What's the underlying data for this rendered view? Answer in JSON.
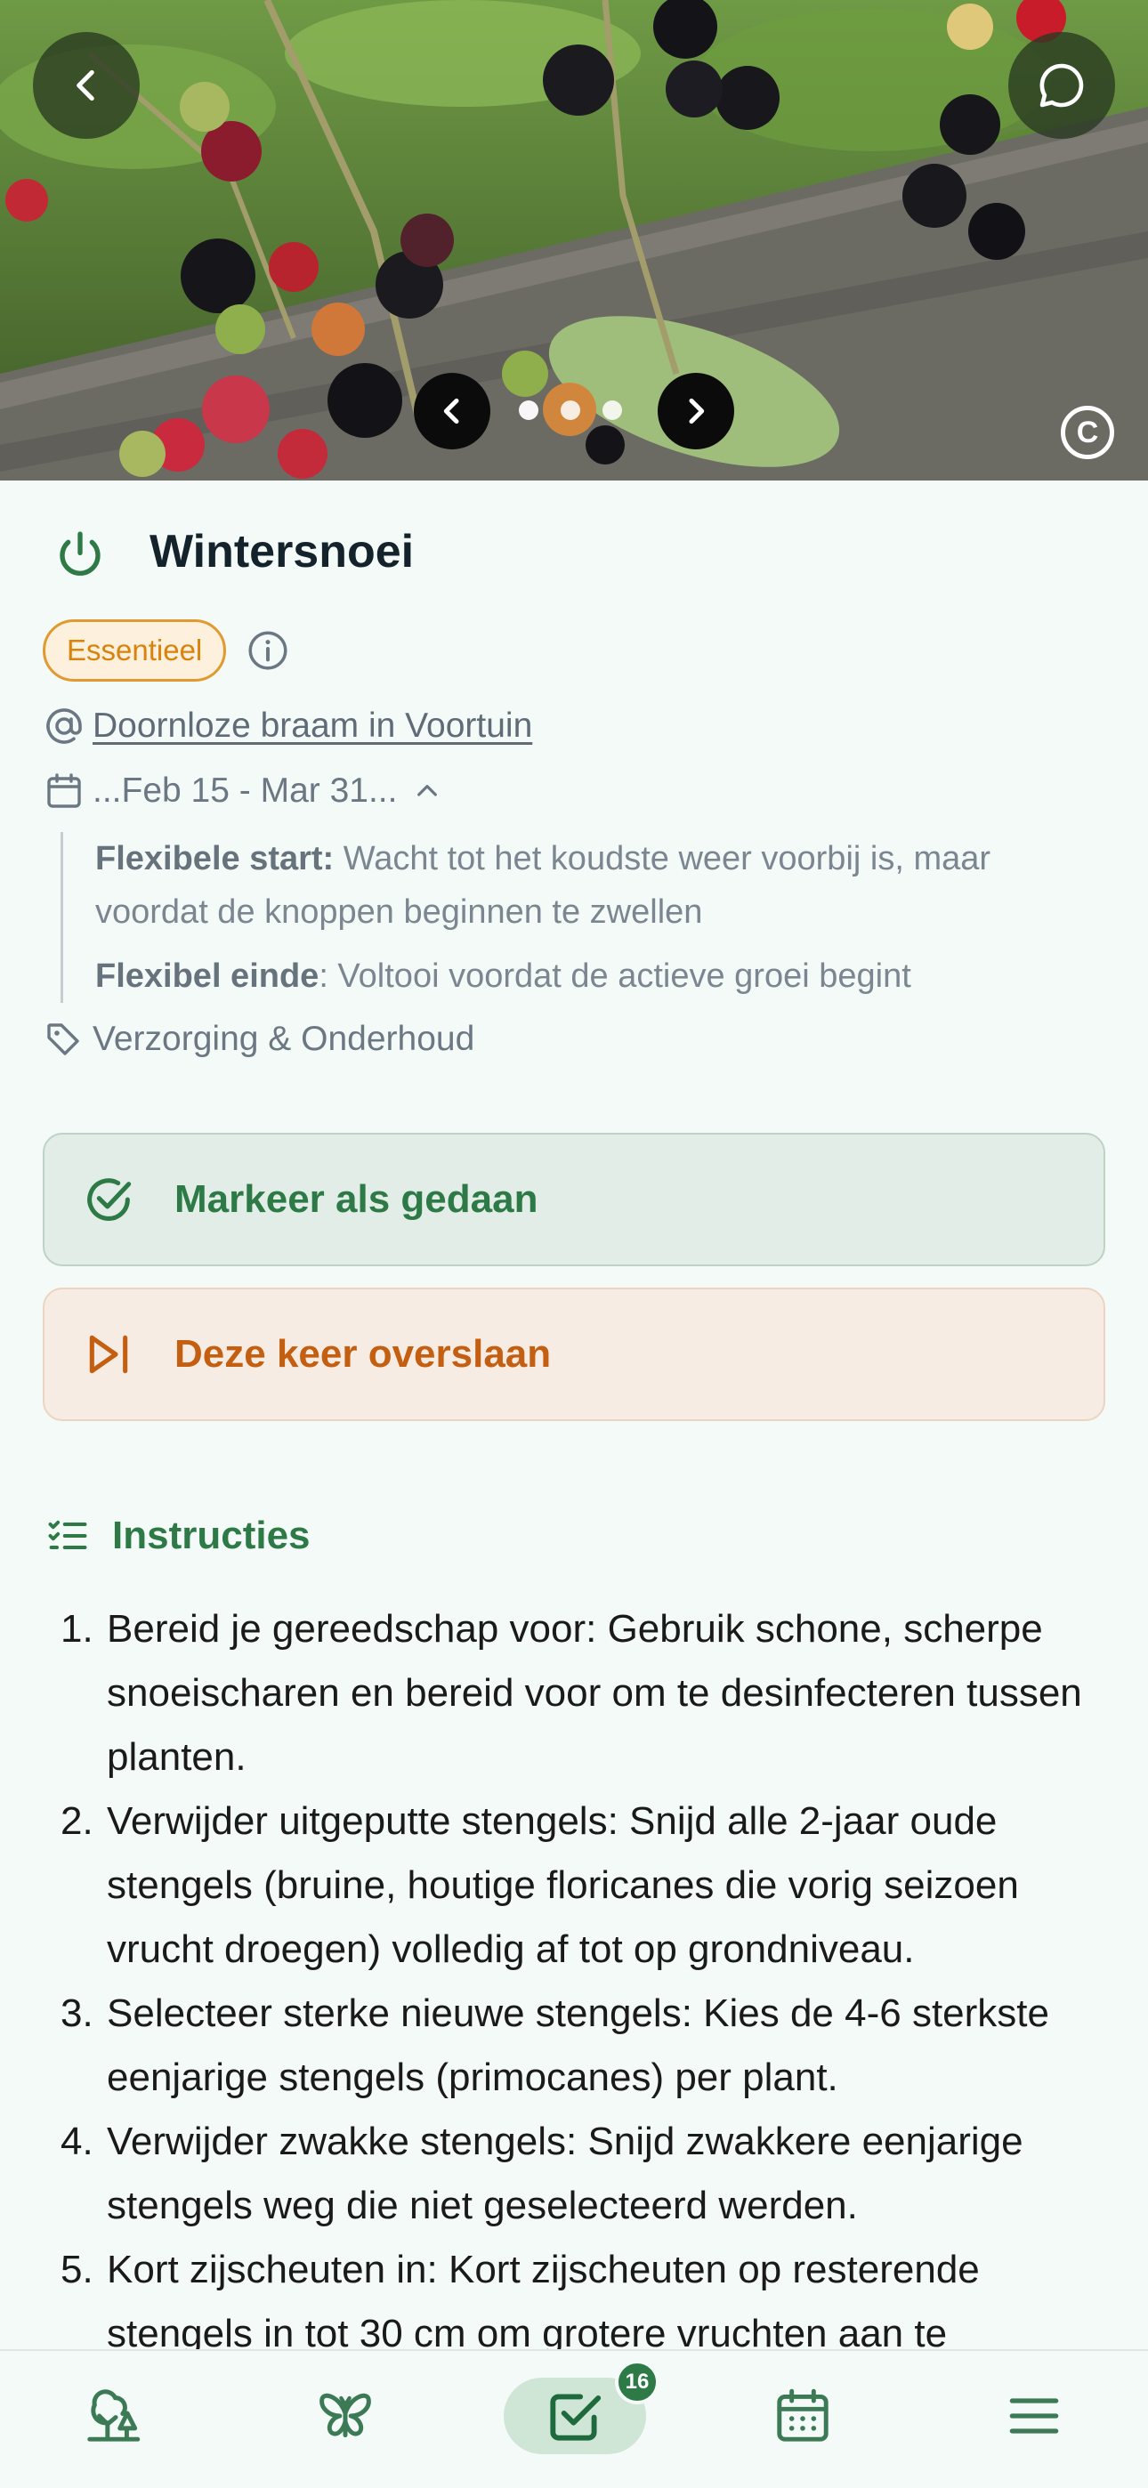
{
  "hero": {
    "image_subject": "blackberries",
    "copyright_symbol": "C",
    "carousel": {
      "total_dots": 3
    }
  },
  "task": {
    "title": "Wintersnoei",
    "badge": "Essentieel",
    "plant_link": "Doornloze braam in Voortuin",
    "date_range": "...Feb 15 - Mar 31...",
    "flex_start_label": "Flexibele start:",
    "flex_start_text": "Wacht tot het koudste weer voorbij is, maar voordat de knoppen beginnen te zwellen",
    "flex_end_label": "Flexibel einde",
    "flex_end_text": ": Voltooi voordat de actieve groei begint",
    "category": "Verzorging & Onderhoud"
  },
  "actions": {
    "done_label": "Markeer als gedaan",
    "skip_label": "Deze keer overslaan"
  },
  "instructions": {
    "heading": "Instructies",
    "steps": [
      {
        "num": "1.",
        "text": "Bereid je gereedschap voor: Gebruik schone, scherpe snoeischaren en bereid voor om te desinfecteren tussen planten."
      },
      {
        "num": "2.",
        "text": "Verwijder uitgeputte stengels: Snijd alle 2-jaar oude stengels (bruine, houtige floricanes die vorig seizoen vrucht droegen) volledig af tot op grondniveau."
      },
      {
        "num": "3.",
        "text": "Selecteer sterke nieuwe stengels: Kies de 4-6 sterkste eenjarige stengels (primocanes) per plant."
      },
      {
        "num": "4.",
        "text": "Verwijder zwakke stengels: Snijd zwakkere eenjarige stengels weg die niet geselecteerd werden."
      },
      {
        "num": "5.",
        "text": "Kort zijscheuten in: Kort zijscheuten op resterende stengels in tot 30 cm om grotere vruchten aan te"
      }
    ]
  },
  "bottom_nav": {
    "tasks_badge": "16",
    "accent": "#2d7a47"
  },
  "colors": {
    "primary_green": "#2d7a47",
    "skip_orange": "#c45e10",
    "badge_orange": "#d9820c",
    "background": "#f4faf7"
  }
}
